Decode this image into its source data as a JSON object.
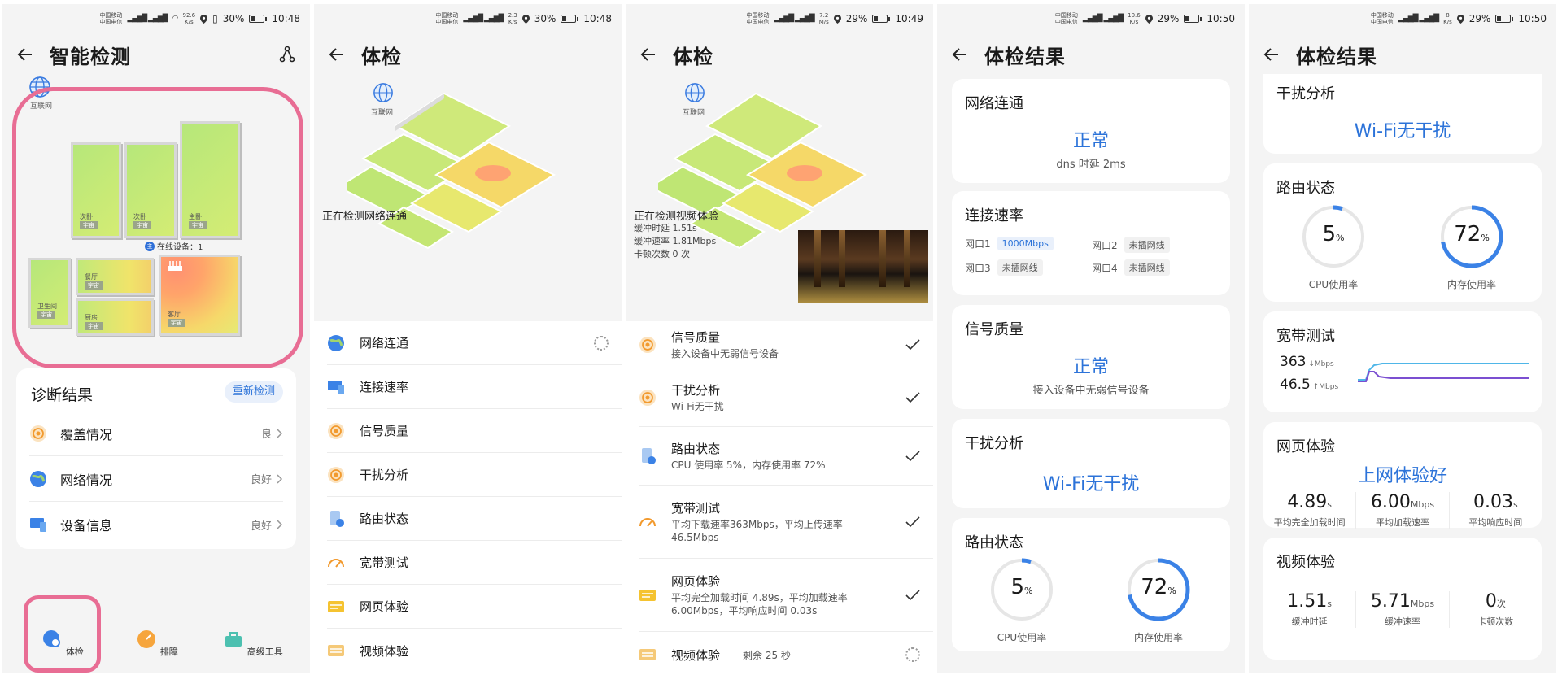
{
  "colors": {
    "accent": "#2c73d9",
    "highlight": "#e86d94",
    "panel_bg": "#f4f4f4"
  },
  "screens": [
    {
      "status": {
        "carrier1": "中国移动",
        "carrier2": "中国电信",
        "speed_value": "92.6",
        "speed_unit": "K/s",
        "battery": "30%",
        "battery_level": 0.3,
        "time": "10:48"
      },
      "title": "智能检测",
      "globe_label": "互联网",
      "rooms": [
        {
          "name": "次卧",
          "tag": "宇宙"
        },
        {
          "name": "次卧",
          "tag": "宇宙"
        },
        {
          "name": "主卧",
          "tag": "宇宙"
        },
        {
          "name": "卫生间",
          "tag": "宇宙"
        },
        {
          "name": "餐厅",
          "tag": "宇宙"
        },
        {
          "name": "厨房",
          "tag": "宇宙"
        },
        {
          "name": "客厅",
          "tag": "宇宙"
        }
      ],
      "online_devices": "在线设备：1",
      "diag": {
        "title": "诊断结果",
        "recheck": "重新检测",
        "rows": [
          {
            "label": "覆盖情况",
            "value": "良"
          },
          {
            "label": "网络情况",
            "value": "良好"
          },
          {
            "label": "设备信息",
            "value": "良好"
          }
        ]
      },
      "nav": [
        {
          "label": "体检"
        },
        {
          "label": "排障"
        },
        {
          "label": "高级工具"
        }
      ]
    },
    {
      "status": {
        "carrier1": "中国移动",
        "carrier2": "中国电信",
        "speed_value": "2.3",
        "speed_unit": "K/s",
        "battery": "30%",
        "battery_level": 0.3,
        "time": "10:48"
      },
      "title": "体检",
      "globe_label": "互联网",
      "caption": "正在检测网络连通",
      "items": [
        {
          "label": "网络连通"
        },
        {
          "label": "连接速率"
        },
        {
          "label": "信号质量"
        },
        {
          "label": "干扰分析"
        },
        {
          "label": "路由状态"
        },
        {
          "label": "宽带测试"
        },
        {
          "label": "网页体验"
        },
        {
          "label": "视频体验"
        }
      ]
    },
    {
      "status": {
        "carrier1": "中国移动",
        "carrier2": "中国电信",
        "speed_value": "7.2",
        "speed_unit": "M/s",
        "battery": "29%",
        "battery_level": 0.29,
        "time": "10:49"
      },
      "title": "体检",
      "globe_label": "互联网",
      "caption": "正在检测视频体验",
      "sub_lines": [
        "缓冲时延 1.51s",
        "缓冲速率 1.81Mbps",
        "卡顿次数 0 次"
      ],
      "items": [
        {
          "label": "信号质量",
          "desc": "接入设备中无弱信号设备"
        },
        {
          "label": "干扰分析",
          "desc": "Wi-Fi无干扰"
        },
        {
          "label": "路由状态",
          "desc": "CPU 使用率 5%，内存使用率 72%"
        },
        {
          "label": "宽带测试",
          "desc": "平均下载速率363Mbps，平均上传速率 46.5Mbps"
        },
        {
          "label": "网页体验",
          "desc": "平均完全加载时间 4.89s，平均加载速率 6.00Mbps，平均响应时间 0.03s"
        },
        {
          "label": "视频体验",
          "desc": "剩余 25 秒"
        }
      ]
    },
    {
      "status": {
        "carrier1": "中国移动",
        "carrier2": "中国电信",
        "speed_value": "10.6",
        "speed_unit": "K/s",
        "battery": "29%",
        "battery_level": 0.29,
        "time": "10:50"
      },
      "title": "体检结果",
      "net": {
        "title": "网络连通",
        "value": "正常",
        "sub": "dns 时延 2ms"
      },
      "rate": {
        "title": "连接速率",
        "ports": [
          {
            "name": "网口1",
            "value": "1000Mbps"
          },
          {
            "name": "网口2",
            "value": "未插网线"
          },
          {
            "name": "网口3",
            "value": "未插网线"
          },
          {
            "name": "网口4",
            "value": "未插网线"
          }
        ]
      },
      "signal": {
        "title": "信号质量",
        "value": "正常",
        "sub": "接入设备中无弱信号设备"
      },
      "interf": {
        "title": "干扰分析",
        "value": "Wi-Fi无干扰"
      },
      "router": {
        "title": "路由状态",
        "cpu": "5",
        "cpu_label": "CPU使用率",
        "mem": "72",
        "mem_label": "内存使用率",
        "unit": "%"
      }
    },
    {
      "status": {
        "carrier1": "中国移动",
        "carrier2": "中国电信",
        "speed_value": "8",
        "speed_unit": "K/s",
        "battery": "29%",
        "battery_level": 0.29,
        "time": "10:50"
      },
      "title": "体检结果",
      "interf": {
        "title": "干扰分析",
        "value": "Wi-Fi无干扰"
      },
      "router": {
        "title": "路由状态",
        "cpu": "5",
        "cpu_label": "CPU使用率",
        "mem": "72",
        "mem_label": "内存使用率",
        "unit": "%"
      },
      "bw": {
        "title": "宽带测试",
        "down": "363",
        "up": "46.5",
        "unit": "Mbps"
      },
      "web": {
        "title": "网页体验",
        "value": "上网体验好",
        "metrics": [
          {
            "v": "4.89",
            "u": "s",
            "l": "平均完全加载时间"
          },
          {
            "v": "6.00",
            "u": "Mbps",
            "l": "平均加载速率"
          },
          {
            "v": "0.03",
            "u": "s",
            "l": "平均响应时间"
          }
        ]
      },
      "video": {
        "title": "视频体验",
        "metrics": [
          {
            "v": "1.51",
            "u": "s",
            "l": "缓冲时延"
          },
          {
            "v": "5.71",
            "u": "Mbps",
            "l": "缓冲速率"
          },
          {
            "v": "0",
            "u": "次",
            "l": "卡顿次数"
          }
        ]
      }
    }
  ]
}
